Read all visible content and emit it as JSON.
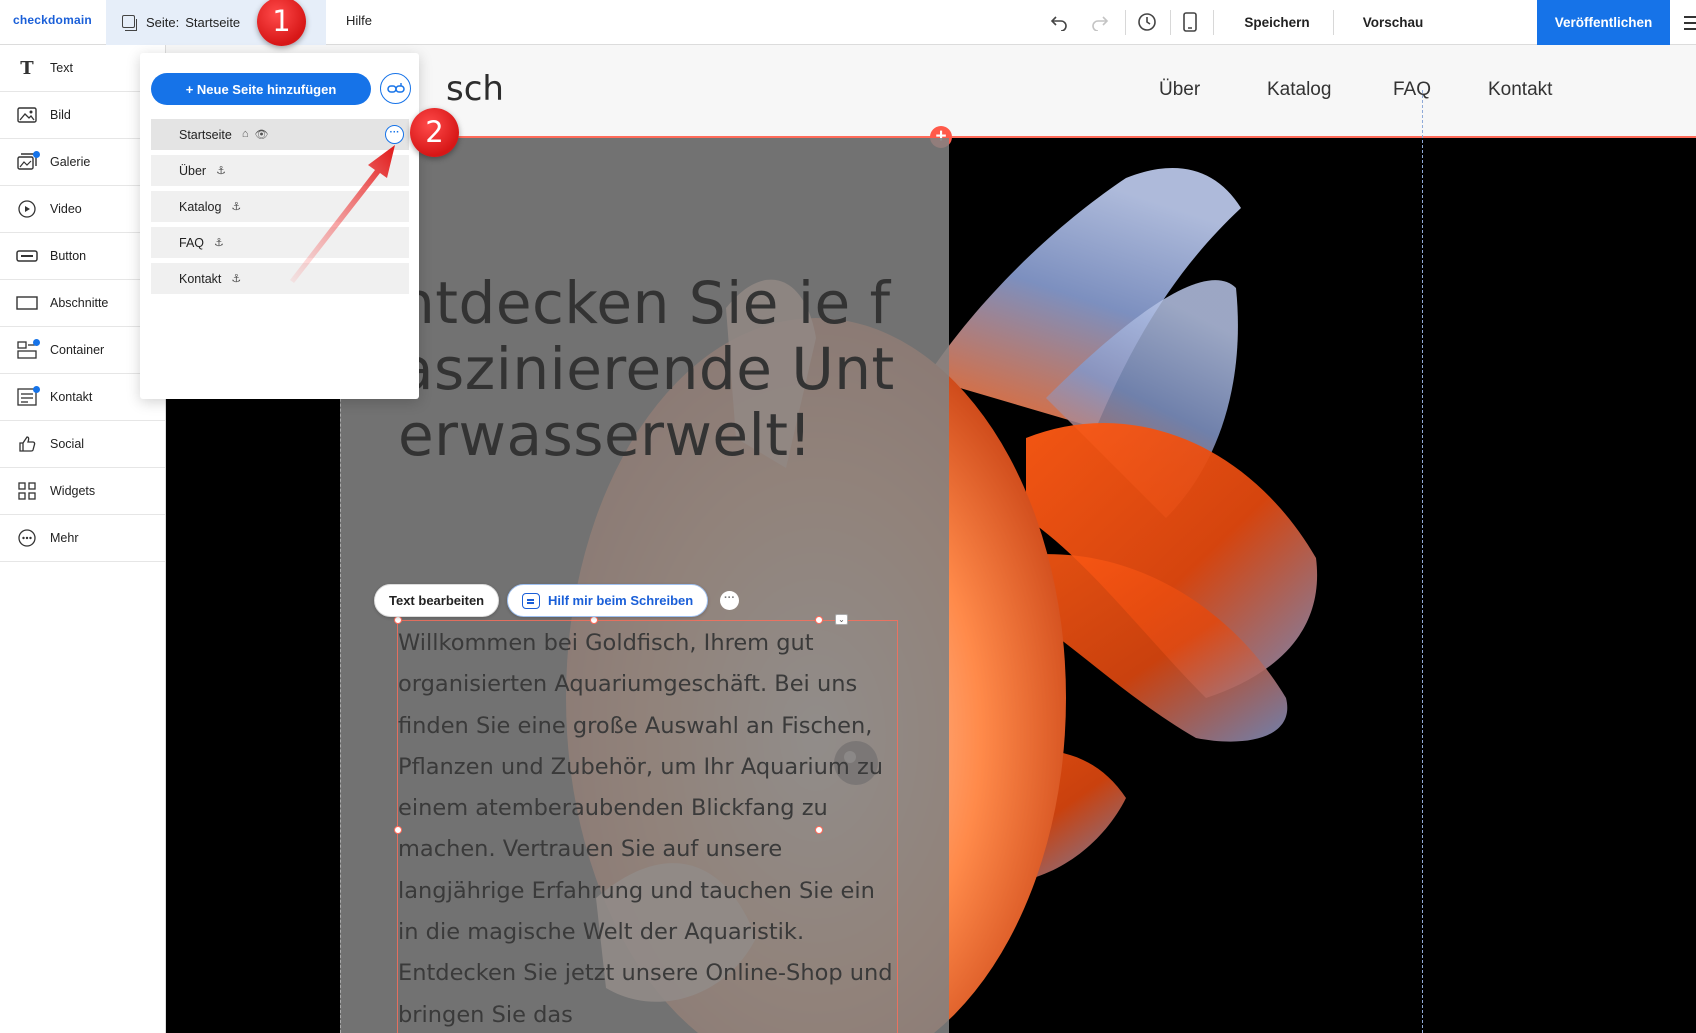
{
  "topbar": {
    "logo": "checkdomain",
    "page_prefix": "Seite:",
    "page_current": "Startseite",
    "help": "Hilfe",
    "save": "Speichern",
    "preview": "Vorschau",
    "publish": "Veröffentlichen"
  },
  "sidebar": {
    "items": [
      {
        "label": "Text",
        "icon": "text-icon"
      },
      {
        "label": "Bild",
        "icon": "image-icon"
      },
      {
        "label": "Galerie",
        "icon": "gallery-icon"
      },
      {
        "label": "Video",
        "icon": "video-icon"
      },
      {
        "label": "Button",
        "icon": "button-icon"
      },
      {
        "label": "Abschnitte",
        "icon": "section-icon"
      },
      {
        "label": "Container",
        "icon": "container-icon"
      },
      {
        "label": "Kontakt",
        "icon": "contact-icon"
      },
      {
        "label": "Social",
        "icon": "thumbs-up-icon"
      },
      {
        "label": "Widgets",
        "icon": "widgets-icon"
      },
      {
        "label": "Mehr",
        "icon": "more-icon"
      }
    ]
  },
  "pages_panel": {
    "add_button": "+ Neue Seite hinzufügen",
    "pages": [
      {
        "label": "Startseite",
        "active": true
      },
      {
        "label": "Über"
      },
      {
        "label": "Katalog"
      },
      {
        "label": "FAQ"
      },
      {
        "label": "Kontakt"
      }
    ]
  },
  "site": {
    "brand_fragment": "sch",
    "nav": [
      "Über",
      "Katalog",
      "FAQ",
      "Kontakt"
    ],
    "hero_title": "ntdecken Sie ie faszinierende Unterwasserwelt!",
    "hero_body": "Willkommen bei Goldfisch, Ihrem gut organisierten Aquariumgeschäft. Bei uns finden Sie eine große Auswahl an Fischen, Pflanzen und Zubehör, um Ihr Aquarium zu einem atemberaubenden Blickfang zu machen. Vertrauen Sie auf unsere langjährige Erfahrung und tauchen Sie ein in die magische Welt der Aquaristik. Entdecken Sie jetzt unsere Online-Shop und bringen Sie das"
  },
  "toolbar": {
    "edit_text": "Text bearbeiten",
    "help_write": "Hilf mir beim Schreiben"
  },
  "callouts": [
    "1",
    "2"
  ],
  "colors": {
    "accent": "#1673e8",
    "selection": "#ff6b5a",
    "callout": "#d71717"
  }
}
